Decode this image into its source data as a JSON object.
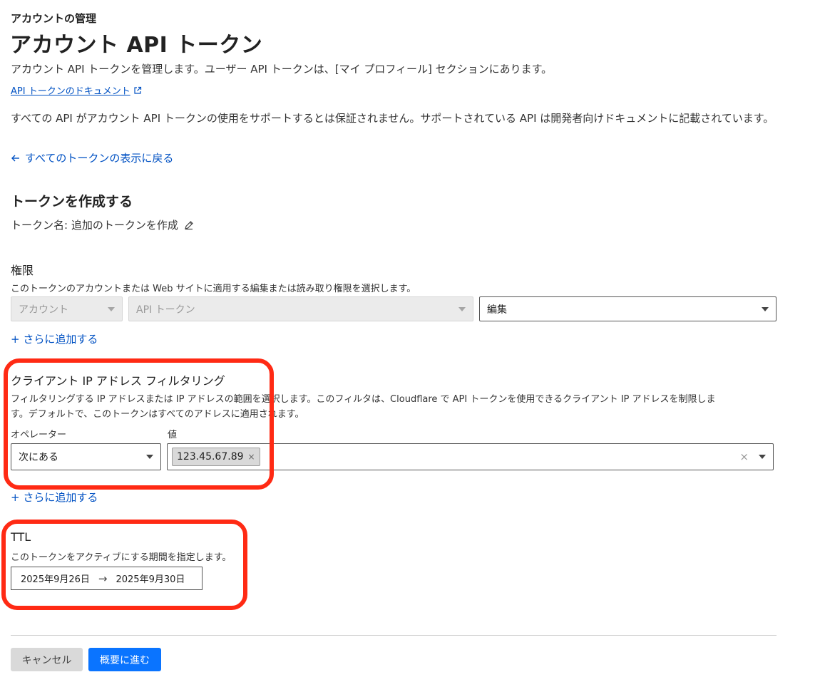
{
  "header": {
    "breadcrumb": "アカウントの管理",
    "title": "アカウント API トークン",
    "subtitle": "アカウント API トークンを管理します。ユーザー API トークンは、[マイ プロフィール] セクションにあります。",
    "doc_link": "API トークンのドキュメント",
    "notice": "すべての API がアカウント API トークンの使用をサポートするとは保証されません。サポートされている API は開発者向けドキュメントに記載されています。",
    "back_link": "すべてのトークンの表示に戻る"
  },
  "create": {
    "title": "トークンを作成する",
    "token_name": "トークン名: 追加のトークンを作成"
  },
  "permissions": {
    "label": "権限",
    "description": "このトークンのアカウントまたは Web サイトに適用する編集または読み取り権限を選択します。",
    "scope_select": "アカウント",
    "resource_select": "API トークン",
    "access_select": "編集",
    "add_more": "+ さらに追加する"
  },
  "ip_filter": {
    "label": "クライアント IP アドレス フィルタリング",
    "description_line1": "フィルタリングする IP アドレスまたは IP アドレスの範囲を選択します。このフィルタは、Cloudflare で API トークンを使用できるクライアント IP アドレスを制限しま",
    "description_line2": "す。デフォルトで、このトークンはすべてのアドレスに適用されます。",
    "operator_label": "オペレーター",
    "value_label": "値",
    "operator_value": "次にある",
    "value_chip": "123.45.67.89",
    "add_more": "+ さらに追加する"
  },
  "ttl": {
    "label": "TTL",
    "description": "このトークンをアクティブにする期間を指定します。",
    "start_date": "2025年9月26日",
    "end_date": "2025年9月30日"
  },
  "footer": {
    "cancel": "キャンセル",
    "next": "概要に進む"
  },
  "colors": {
    "link": "#0051c3",
    "primary_button": "#0a74ff",
    "highlight": "#ff2a14"
  }
}
